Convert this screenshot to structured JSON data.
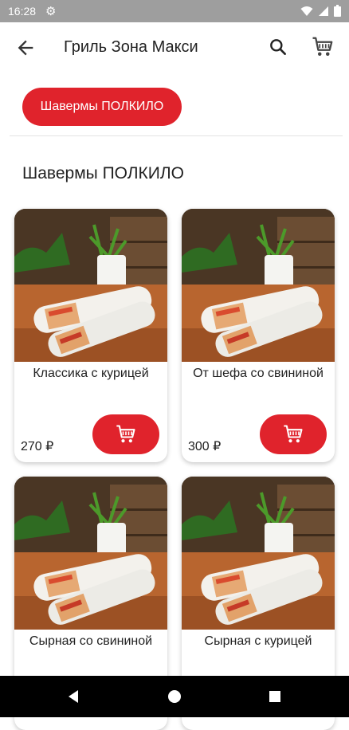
{
  "status_bar": {
    "time": "16:28",
    "icons": [
      "gear-icon",
      "wifi-icon",
      "signal-icon",
      "battery-icon"
    ]
  },
  "app_bar": {
    "title": "Гриль Зона Макси",
    "back_icon": "arrow-left-icon",
    "search_icon": "search-icon",
    "cart_icon": "cart-icon"
  },
  "category_chip": {
    "label": "Шавермы ПОЛКИЛО"
  },
  "section": {
    "title": "Шавермы ПОЛКИЛО"
  },
  "products": [
    {
      "name": "Классика с курицей",
      "price": "270 ₽",
      "image": "shawarma-photo"
    },
    {
      "name": "От шефа со свининой",
      "price": "300 ₽",
      "image": "shawarma-photo"
    },
    {
      "name": "Сырная со свининой",
      "price": "",
      "image": "shawarma-photo"
    },
    {
      "name": "Сырная с курицей",
      "price": "",
      "image": "shawarma-photo"
    }
  ],
  "colors": {
    "accent": "#e0232c",
    "status_bar": "#9e9e9e",
    "nav_bar": "#000000"
  },
  "nav_bar": {
    "icons": [
      "back-triangle-icon",
      "home-circle-icon",
      "recents-square-icon"
    ]
  }
}
